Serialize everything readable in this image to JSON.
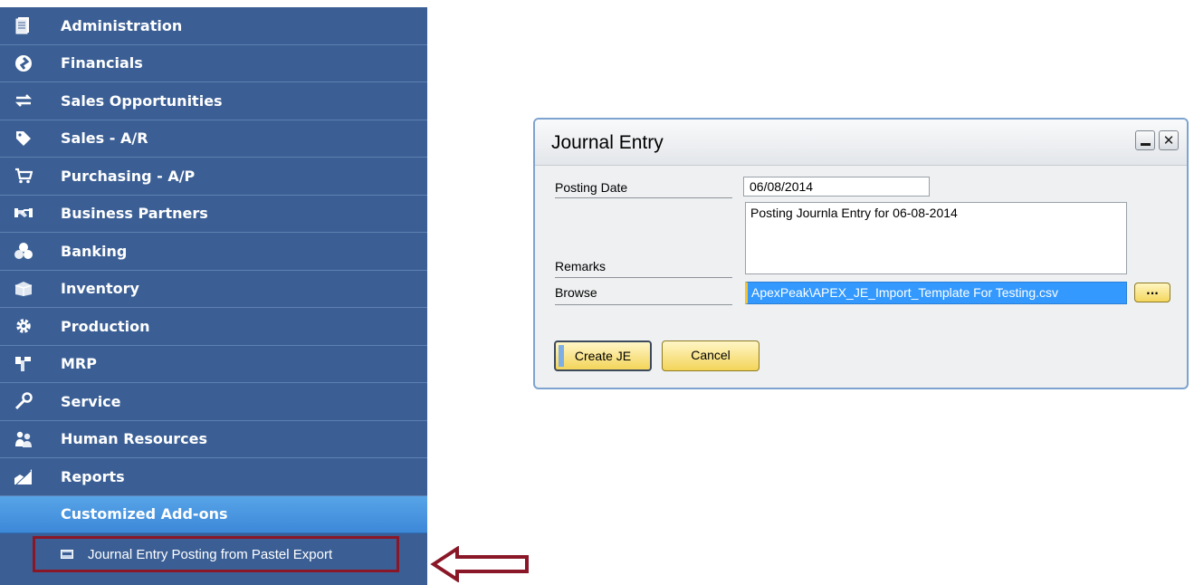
{
  "sidebar": {
    "items": [
      {
        "label": "Administration",
        "icon": "document-icon"
      },
      {
        "label": "Financials",
        "icon": "financials-icon"
      },
      {
        "label": "Sales Opportunities",
        "icon": "opportunities-icon"
      },
      {
        "label": "Sales - A/R",
        "icon": "tag-icon"
      },
      {
        "label": "Purchasing - A/P",
        "icon": "cart-icon"
      },
      {
        "label": "Business Partners",
        "icon": "handshake-icon"
      },
      {
        "label": "Banking",
        "icon": "coins-icon"
      },
      {
        "label": "Inventory",
        "icon": "box-icon"
      },
      {
        "label": "Production",
        "icon": "gear-icon"
      },
      {
        "label": "MRP",
        "icon": "mrp-icon"
      },
      {
        "label": "Service",
        "icon": "wrench-icon"
      },
      {
        "label": "Human Resources",
        "icon": "people-icon"
      },
      {
        "label": "Reports",
        "icon": "chart-icon"
      },
      {
        "label": "Customized Add-ons",
        "icon": ""
      }
    ],
    "submenu": {
      "label": "Journal Entry Posting from Pastel Export",
      "icon": "form-icon"
    }
  },
  "colors": {
    "sidebar": "#3b5f95",
    "active": "#4a97e0",
    "highlight_border": "#8a1727",
    "arrow": "#8a1727"
  },
  "dialog": {
    "title": "Journal Entry",
    "fields": {
      "posting_date_label": "Posting Date",
      "posting_date_value": "06/08/2014",
      "remarks_label": "Remarks",
      "remarks_value": "Posting Journla Entry for 06-08-2014",
      "browse_label": "Browse",
      "browse_value": "ApexPeak\\APEX_JE_Import_Template For Testing.csv",
      "browse_button": "..."
    },
    "buttons": {
      "create": "Create JE",
      "cancel": "Cancel"
    }
  }
}
